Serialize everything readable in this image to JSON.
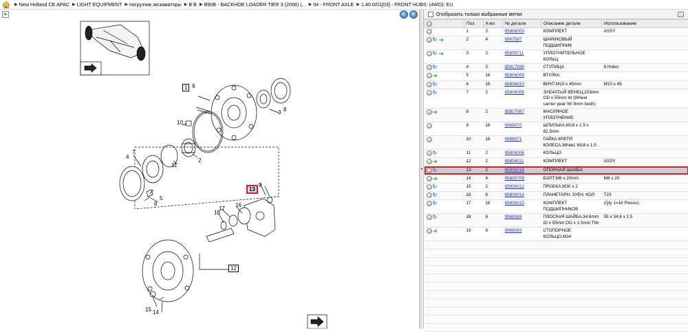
{
  "breadcrumbs": [
    "New Holland CE APAC",
    "LIGHT EQUIPMENT",
    "погрузчик экскаваторы",
    "B B",
    "B90B - BACKHOE LOADER TIER 3 (2008) (...",
    "04 - FRONT AXLE",
    "1.40.0/01[03] - FRONT HUBS: (4WD): EU"
  ],
  "filter": {
    "label": "Отобразить только выбранные метки",
    "checked": false
  },
  "table": {
    "headers": [
      "",
      "Поз.",
      "К-во",
      "№ детали",
      "Описание детали",
      "Использование"
    ],
    "rows": [
      {
        "icons": [
          "circle"
        ],
        "pos": "1",
        "qty": "2",
        "part": "85806003",
        "desc": "КОМПЛЕКТ",
        "use": "ASSY"
      },
      {
        "icons": [
          "circle",
          "blue",
          "green"
        ],
        "pos": "2",
        "qty": "4",
        "part": "9967587",
        "desc": "ШАРИКОВЫЙ ПОДШИПНИК",
        "use": ""
      },
      {
        "icons": [
          "circle",
          "blue",
          "green"
        ],
        "pos": "3",
        "qty": "2",
        "part": "85805711",
        "desc": "УПЛОТНИТЕЛЬНОЕ КОЛЬЦ",
        "use": ""
      },
      {
        "icons": [
          "circle",
          "blue"
        ],
        "pos": "4",
        "qty": "2",
        "part": "85817698",
        "desc": "СТУПИЦА",
        "use": "8 Holes"
      },
      {
        "icons": [
          "circle",
          "green"
        ],
        "pos": "5",
        "qty": "16",
        "part": "85806009",
        "desc": "ВТУЛКА",
        "use": ""
      },
      {
        "icons": [
          "circle",
          "blue"
        ],
        "pos": "6",
        "qty": "16",
        "part": "85806010",
        "desc": "ВИНТ,M10 x 45mm",
        "use": "M10 x 45"
      },
      {
        "icons": [
          "circle",
          "blue"
        ],
        "pos": "7",
        "qty": "2",
        "part": "85806008",
        "desc": "ЗУБЧАТЫЙ ВЕНЕЦ,203mm OD x 55mm W (Wheel carrier gear W/ 8mm teeth)",
        "use": ""
      },
      {
        "icons": [
          "circle",
          "green"
        ],
        "pos": "8",
        "qty": "2",
        "part": "85827067",
        "desc": "МАСЛЯНОЕ УПЛОТНЕНИЕ",
        "use": ""
      },
      {
        "icons": [
          "circle"
        ],
        "pos": "9",
        "qty": "16",
        "part": "9968070",
        "desc": "ШПИЛЬКА,M18 x 1.5 x 82.5mm",
        "use": ""
      },
      {
        "icons": [
          "circle"
        ],
        "pos": "10",
        "qty": "16",
        "part": "9968071",
        "desc": "ГАЙКА КРЕПЛ КОЛЕСА,Wheel, M18 x 1.5",
        "use": ""
      },
      {
        "icons": [
          "circle",
          "blue"
        ],
        "pos": "11",
        "qty": "2",
        "part": "85806006",
        "desc": "КОЛЬЦО",
        "use": ""
      },
      {
        "icons": [
          "circle",
          "green"
        ],
        "pos": "12",
        "qty": "2",
        "part": "85806011",
        "desc": "КОМПЛЕКТ",
        "use": "ASSY"
      },
      {
        "icons": [
          "circle",
          "blue"
        ],
        "pos": "13",
        "qty": "2",
        "part": "85806016",
        "desc": "ОПОРНАЯ ШАЙБА",
        "use": "",
        "selected": true
      },
      {
        "icons": [
          "circle",
          "green"
        ],
        "pos": "14",
        "qty": "4",
        "part": "85805709",
        "desc": "БОЛТ,M8 x 20mm",
        "use": "M8 x 20"
      },
      {
        "icons": [
          "circle",
          "blue"
        ],
        "pos": "15",
        "qty": "2",
        "part": "85806012",
        "desc": "ПРОБКА,M30 x 2",
        "use": ""
      },
      {
        "icons": [
          "circle",
          "blue"
        ],
        "pos": "16",
        "qty": "6",
        "part": "85806014",
        "desc": "ПЛАНЕТАРН. ЗУБЧ. КОЛ",
        "use": "T23"
      },
      {
        "icons": [
          "circle",
          "blue"
        ],
        "pos": "17",
        "qty": "18",
        "part": "85806015",
        "desc": "КОМПЛЕКТ ПОДШИПНИКОВ",
        "use": "(Qty 1=18 Pieces)"
      },
      {
        "icons": [
          "circle",
          "blue"
        ],
        "pos": "18",
        "qty": "6",
        "part": "9968084",
        "desc": "ПЛОСКАЯ ШАЙБА,34.6mm ID x 55mm OD x 1.5mm Thk",
        "use": "55 x 34.6 x 1.5"
      },
      {
        "icons": [
          "circle",
          "green"
        ],
        "pos": "19",
        "qty": "6",
        "part": "9968083",
        "desc": "СТОПОРНОЕ КОЛЬЦО,M34",
        "use": ""
      }
    ]
  },
  "diagram": {
    "callouts": [
      "1",
      "9",
      "8",
      "10",
      "3",
      "2",
      "7",
      "4",
      "11",
      "5",
      "6",
      "13",
      "9",
      "17",
      "18",
      "16",
      "12",
      "15",
      "14"
    ],
    "highlighted": "13"
  }
}
